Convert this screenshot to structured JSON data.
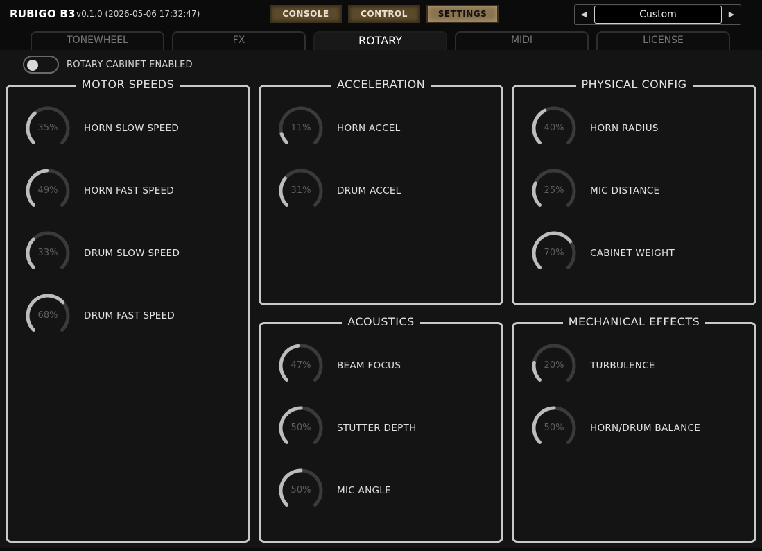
{
  "header": {
    "app_name": "RUBIGO B3",
    "version": "v0.1.0 (2026-05-06 17:32:47)"
  },
  "mode_buttons": [
    {
      "label": "CONSOLE",
      "active": false
    },
    {
      "label": "CONTROL",
      "active": false
    },
    {
      "label": "SETTINGS",
      "active": true
    }
  ],
  "preset": {
    "value": "Custom",
    "prev_icon": "triangle-left-icon",
    "next_icon": "triangle-right-icon"
  },
  "tabs": [
    {
      "label": "TONEWHEEL",
      "active": false
    },
    {
      "label": "FX",
      "active": false
    },
    {
      "label": "ROTARY",
      "active": true
    },
    {
      "label": "MIDI",
      "active": false
    },
    {
      "label": "LICENSE",
      "active": false
    }
  ],
  "rotary_toggle": {
    "label": "ROTARY CABINET ENABLED",
    "on": false
  },
  "colors": {
    "panel_border": "#c9c9c9",
    "knob_track": "#3a3a3a",
    "knob_fill": "#bdbdbd",
    "mode_button": "#5c4a2a",
    "mode_button_active": "#8a7350"
  },
  "panels": {
    "motor_speeds": {
      "title": "MOTOR SPEEDS",
      "knobs": [
        {
          "label": "HORN SLOW SPEED",
          "value_text": "35%",
          "value": 0.35
        },
        {
          "label": "HORN FAST SPEED",
          "value_text": "49%",
          "value": 0.49
        },
        {
          "label": "DRUM SLOW SPEED",
          "value_text": "33%",
          "value": 0.33
        },
        {
          "label": "DRUM FAST SPEED",
          "value_text": "68%",
          "value": 0.68
        }
      ]
    },
    "acceleration": {
      "title": "ACCELERATION",
      "knobs": [
        {
          "label": "HORN ACCEL",
          "value_text": "11%",
          "value": 0.11
        },
        {
          "label": "DRUM ACCEL",
          "value_text": "31%",
          "value": 0.31
        }
      ]
    },
    "physical_config": {
      "title": "PHYSICAL CONFIG",
      "knobs": [
        {
          "label": "HORN RADIUS",
          "value_text": "40%",
          "value": 0.4
        },
        {
          "label": "MIC DISTANCE",
          "value_text": "25%",
          "value": 0.25
        },
        {
          "label": "CABINET WEIGHT",
          "value_text": "70%",
          "value": 0.7
        }
      ]
    },
    "acoustics": {
      "title": "ACOUSTICS",
      "knobs": [
        {
          "label": "BEAM FOCUS",
          "value_text": "47%",
          "value": 0.47
        },
        {
          "label": "STUTTER DEPTH",
          "value_text": "50%",
          "value": 0.5
        },
        {
          "label": "MIC ANGLE",
          "value_text": "50%",
          "value": 0.5
        }
      ]
    },
    "mechanical_effects": {
      "title": "MECHANICAL EFFECTS",
      "knobs": [
        {
          "label": "TURBULENCE",
          "value_text": "20%",
          "value": 0.2
        },
        {
          "label": "HORN/DRUM BALANCE",
          "value_text": "50%",
          "value": 0.5
        }
      ]
    }
  }
}
